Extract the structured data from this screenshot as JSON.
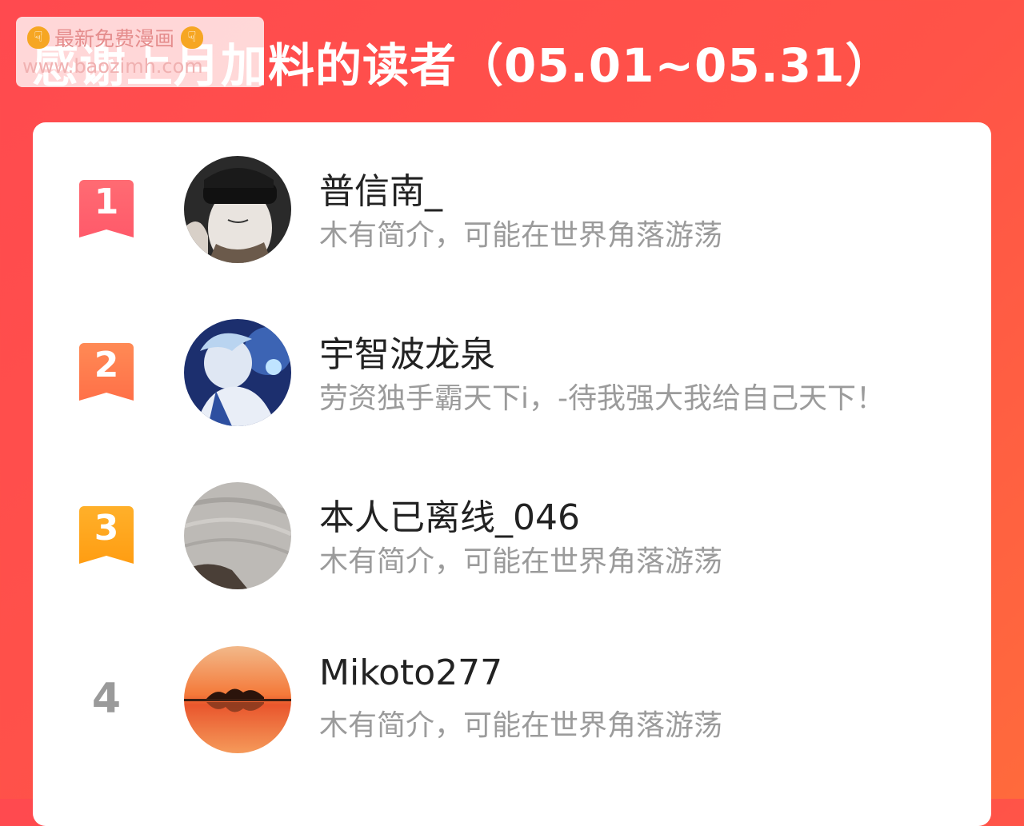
{
  "header": {
    "title": "感谢上月加料的读者（05.01~05.31）"
  },
  "watermark": {
    "line1": "最新免费漫画",
    "line2": "www.baozimh.com"
  },
  "readers": [
    {
      "rank": "1",
      "name": "普信南_",
      "bio": "木有简介，可能在世界角落游荡",
      "badge_color": "#ff5c66"
    },
    {
      "rank": "2",
      "name": "宇智波龙泉",
      "bio": "劳资独手霸天下i，-待我强大我给自己天下！",
      "badge_color": "#ff7a45"
    },
    {
      "rank": "3",
      "name": "本人已离线_046",
      "bio": "木有简介，可能在世界角落游荡",
      "badge_color": "#ffa61a"
    },
    {
      "rank": "4",
      "name": "Mikoto277",
      "bio": "木有简介，可能在世界角落游荡"
    }
  ]
}
